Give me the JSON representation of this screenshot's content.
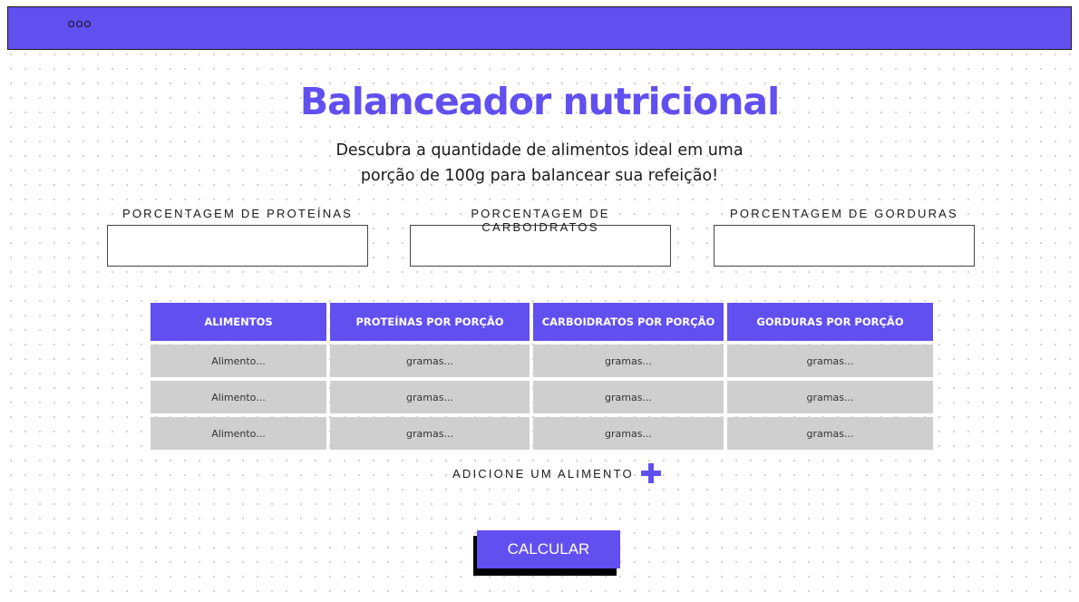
{
  "app": {
    "title": "Balanceador nutricional",
    "subtitle_line1": "Descubra a quantidade de alimentos ideal em uma",
    "subtitle_line2": "porção de 100g para balancear sua refeição!"
  },
  "colors": {
    "accent": "#614ff0",
    "cell_bg": "#cfcfcf"
  },
  "icons": {
    "menu": "three-circles-icon",
    "add": "plus-icon"
  },
  "fields": [
    {
      "label": "PORCENTAGEM DE PROTEÍNAS",
      "value": "",
      "placeholder": ""
    },
    {
      "label": "PORCENTAGEM DE CARBOIDRATOS",
      "value": "",
      "placeholder": ""
    },
    {
      "label": "PORCENTAGEM DE GORDURAS",
      "value": "",
      "placeholder": ""
    }
  ],
  "table": {
    "headers": [
      "ALIMENTOS",
      "PROTEÍNAS POR PORÇÃO",
      "CARBOIDRATOS POR PORÇÃO",
      "GORDURAS POR PORÇÃO"
    ],
    "rows": [
      [
        "Alimento...",
        "gramas...",
        "gramas...",
        "gramas..."
      ],
      [
        "Alimento...",
        "gramas...",
        "gramas...",
        "gramas..."
      ],
      [
        "Alimento...",
        "gramas...",
        "gramas...",
        "gramas..."
      ]
    ]
  },
  "add_food": {
    "label": "ADICIONE UM ALIMENTO"
  },
  "calculate": {
    "label": "CALCULAR"
  }
}
